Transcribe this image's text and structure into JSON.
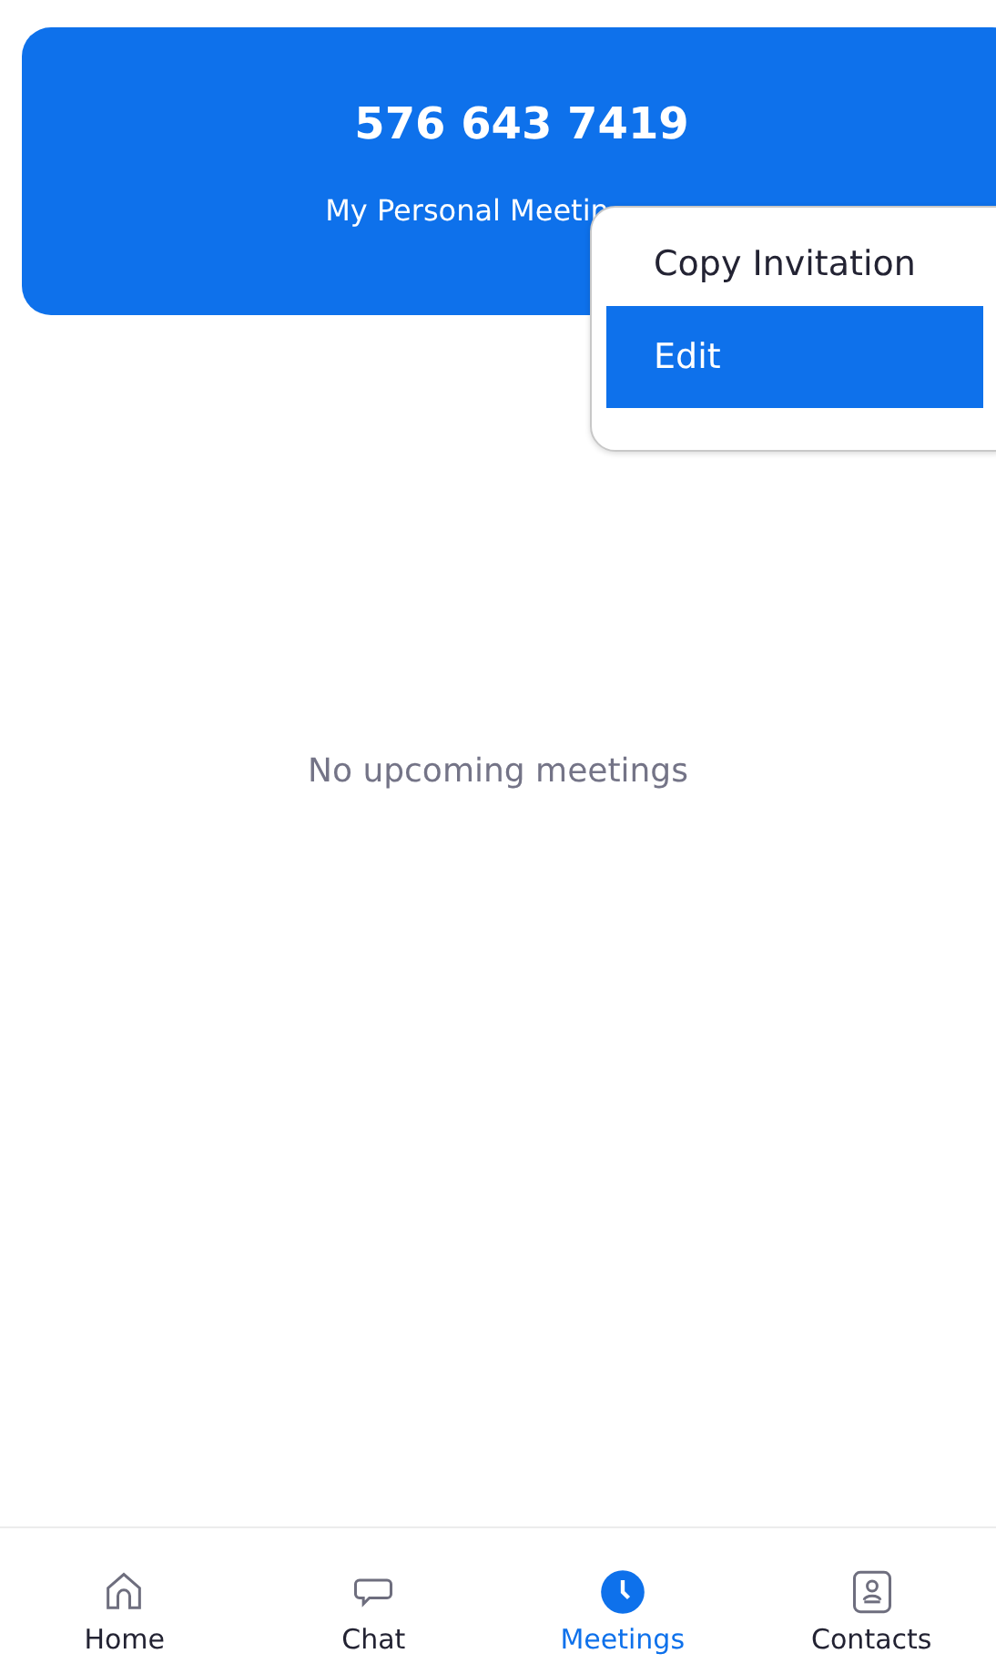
{
  "meeting_card": {
    "meeting_id": "576 643 7419",
    "subtitle": "My Personal Meetin"
  },
  "context_menu": {
    "items": [
      {
        "label": "Copy Invitation",
        "selected": false
      },
      {
        "label": "Edit",
        "selected": true
      }
    ]
  },
  "empty_message": "No upcoming meetings",
  "tab_bar": {
    "tabs": [
      {
        "kind": "home",
        "label": "Home",
        "selected": false
      },
      {
        "kind": "chat",
        "label": "Chat",
        "selected": false
      },
      {
        "kind": "meetings",
        "label": "Meetings",
        "selected": true
      },
      {
        "kind": "contacts",
        "label": "Contacts",
        "selected": false
      }
    ]
  }
}
